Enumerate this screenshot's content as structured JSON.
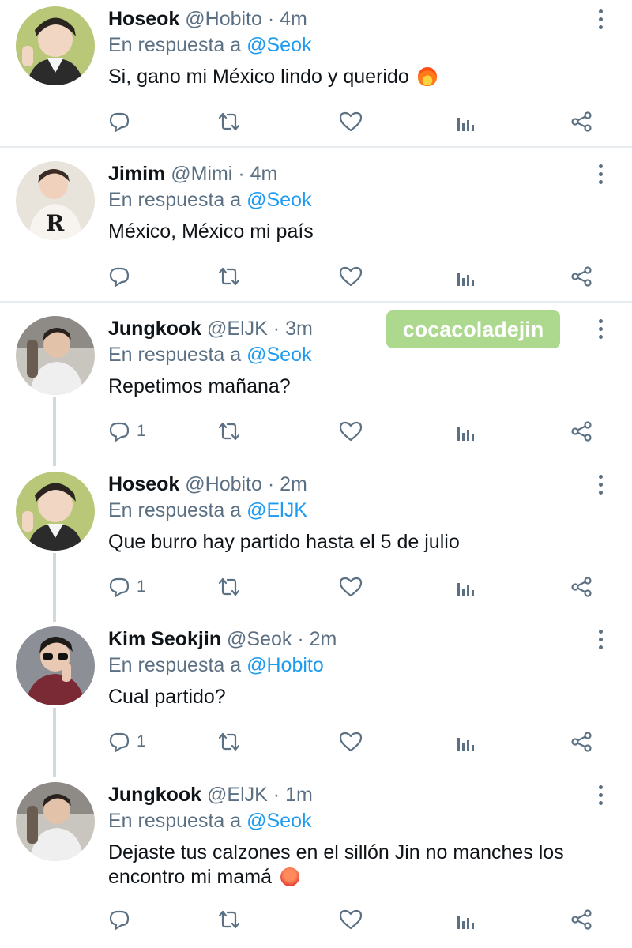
{
  "watermark": "cocacoladejin",
  "tweets": [
    {
      "name": "Hoseok",
      "handle": "@Hobito",
      "time": "4m",
      "reply_prefix": "En respuesta a",
      "reply_to": "@Seok",
      "text": "Si, gano mi México lindo y querido",
      "emoji": "fire",
      "reply_count": ""
    },
    {
      "name": "Jimim",
      "handle": "@Mimi",
      "time": "4m",
      "reply_prefix": "En respuesta a",
      "reply_to": "@Seok",
      "text": "México, México mi país",
      "reply_count": ""
    },
    {
      "name": "Jungkook",
      "handle": "@ElJK",
      "time": "3m",
      "reply_prefix": "En respuesta a",
      "reply_to": "@Seok",
      "text": "Repetimos mañana?",
      "reply_count": "1"
    },
    {
      "name": "Hoseok",
      "handle": "@Hobito",
      "time": "2m",
      "reply_prefix": "En respuesta a",
      "reply_to": "@ElJK",
      "text": "Que burro hay partido hasta el 5 de julio",
      "reply_count": "1"
    },
    {
      "name": "Kim Seokjin",
      "handle": "@Seok",
      "time": "2m",
      "reply_prefix": "En respuesta a",
      "reply_to": "@Hobito",
      "text": "Cual partido?",
      "reply_count": "1"
    },
    {
      "name": "Jungkook",
      "handle": "@ElJK",
      "time": "1m",
      "reply_prefix": "En respuesta a",
      "reply_to": "@Seok",
      "text": "Dejaste tus calzones en el sillón Jin no manches los encontro mi mamá",
      "emoji": "angry-face",
      "reply_count": ""
    }
  ],
  "icons": {
    "reply": "speech-bubble-icon",
    "retweet": "retweet-icon",
    "like": "heart-icon",
    "stats": "bar-chart-icon",
    "share": "share-icon",
    "more": "three-dots-vertical-icon"
  },
  "colors": {
    "accent": "#1d9bf0",
    "muted": "#5b7083",
    "watermark_bg": "#a8d889"
  }
}
